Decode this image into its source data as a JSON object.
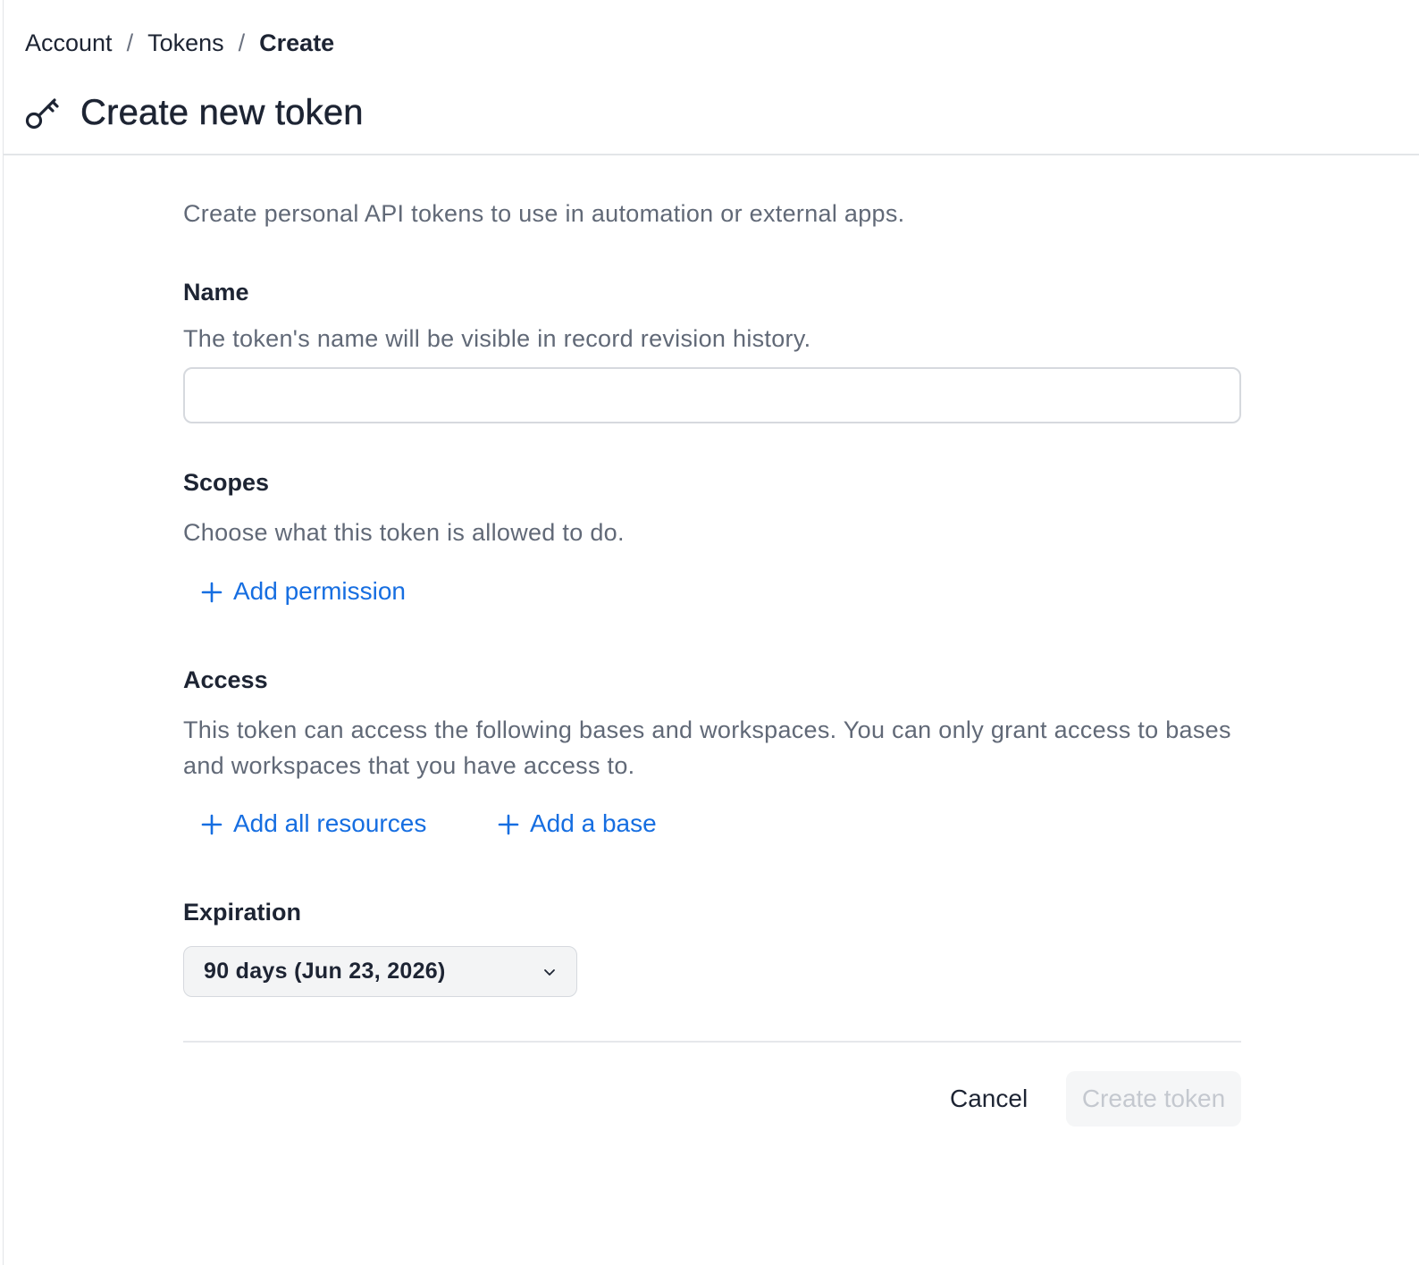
{
  "breadcrumb": {
    "items": [
      "Account",
      "Tokens",
      "Create"
    ],
    "separator": "/"
  },
  "header": {
    "title": "Create new token",
    "icon": "key-icon"
  },
  "intro": "Create personal API tokens to use in automation or external apps.",
  "name_section": {
    "label": "Name",
    "description": "The token's name will be visible in record revision history.",
    "input_value": "",
    "placeholder": ""
  },
  "scopes_section": {
    "label": "Scopes",
    "description": "Choose what this token is allowed to do.",
    "add_permission_label": "Add permission"
  },
  "access_section": {
    "label": "Access",
    "description": "This token can access the following bases and workspaces. You can only grant access to bases and workspaces that you have access to.",
    "add_all_resources_label": "Add all resources",
    "add_base_label": "Add a base"
  },
  "expiration_section": {
    "label": "Expiration",
    "selected": "90 days (Jun 23, 2026)"
  },
  "footer": {
    "cancel_label": "Cancel",
    "create_label": "Create token",
    "create_disabled": true
  },
  "colors": {
    "link": "#166ee1",
    "text": "#1d2433",
    "muted": "#616977",
    "disabled_text": "#c4c8cf"
  }
}
